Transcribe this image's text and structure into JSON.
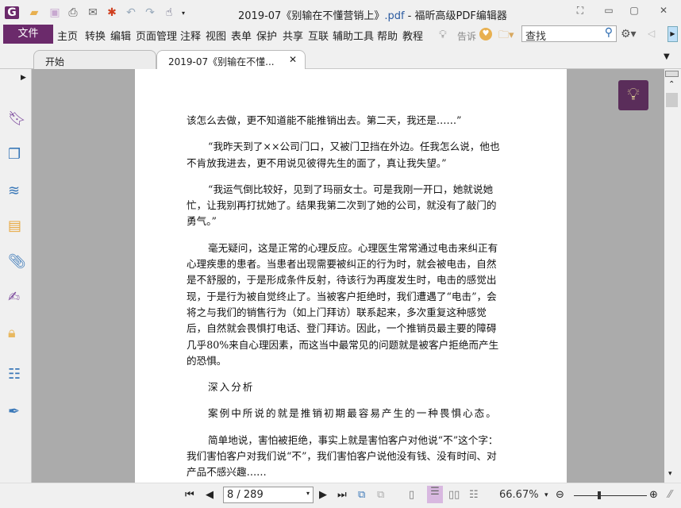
{
  "window": {
    "title_main": "2019-07《别输在不懂营销上》",
    "title_ext": ".pdf",
    "title_app": " - 福昕高级PDF编辑器"
  },
  "menu": {
    "file": "文件",
    "items": [
      "主页",
      "转换",
      "编辑",
      "页面管理",
      "注释",
      "视图",
      "表单",
      "保护",
      "共享",
      "互联",
      "辅助工具",
      "帮助",
      "教程"
    ],
    "tell": "告诉",
    "search_placeholder": "查找"
  },
  "tabs": [
    {
      "label": "开始"
    },
    {
      "label": "2019-07《别输在不懂..."
    }
  ],
  "document": {
    "paragraphs": [
      {
        "indent": false,
        "lines": [
          "该怎么去做，更不知道能不能推销出去。第二天，我还是……”"
        ]
      },
      {
        "indent": true,
        "lines": [
          "“我昨天到了××公司门口，又被门卫挡在外边。任我怎么说，他也",
          "不肯放我进去，更不用说见彼得先生的面了，真让我失望。”"
        ]
      },
      {
        "indent": true,
        "lines": [
          "“我运气倒比较好，见到了玛丽女士。可是我刚一开口，她就说她",
          "忙，让我别再打扰她了。结果我第二次到了她的公司，就没有了敲门的",
          "勇气。”"
        ]
      },
      {
        "indent": true,
        "lines": [
          "毫无疑问，这是正常的心理反应。心理医生常常通过电击来纠正有",
          "心理疾患的患者。当患者出现需要被纠正的行为时，就会被电击，自然",
          "是不舒服的，于是形成条件反射，待该行为再度发生时，电击的感觉出",
          "现，于是行为被自觉终止了。当被客户拒绝时，我们遭遇了“电击”，会",
          "将之与我们的销售行为（如上门拜访）联系起来，多次重复这种感觉",
          "后，自然就会畏惧打电话、登门拜访。因此，一个推销员最主要的障碍",
          "几乎80%来自心理因素，而这当中最常见的问题就是被客户拒绝而产生",
          "的恐惧。"
        ]
      },
      {
        "indent": true,
        "spaced": true,
        "lines": [
          "深入分析"
        ]
      },
      {
        "indent": true,
        "spaced": true,
        "lines": [
          "案例中所说的就是推销初期最容易产生的一种畏惧心态。"
        ]
      },
      {
        "indent": true,
        "lines": [
          "简单地说，害怕被拒绝，事实上就是害怕客户对他说“不”这个字：",
          "我们害怕客户对我们说“不”，我们害怕客户说他没有钱、没有时间、对",
          "产品不感兴趣……"
        ]
      }
    ]
  },
  "status": {
    "page": "8 / 289",
    "zoom": "66.67%",
    "zoom_slider_fraction": 0.35
  },
  "colors": {
    "accent": "#6b2a6b",
    "page_bg": "#ababab",
    "tip": "#5a2d5a"
  }
}
